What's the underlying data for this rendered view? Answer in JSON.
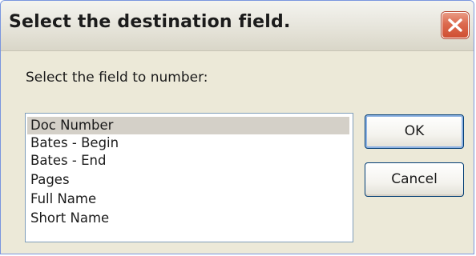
{
  "dialog": {
    "title": "Select the destination field.",
    "prompt": "Select the field to number:"
  },
  "fields_list": {
    "items": [
      {
        "label": "Doc Number",
        "selected": true
      },
      {
        "label": "Bates - Begin",
        "selected": false
      },
      {
        "label": "Bates - End",
        "selected": false
      },
      {
        "label": "Pages",
        "selected": false
      },
      {
        "label": "Full Name",
        "selected": false
      },
      {
        "label": "Short Name",
        "selected": false
      }
    ]
  },
  "buttons": {
    "ok": "OK",
    "cancel": "Cancel"
  },
  "icons": {
    "close": "close-icon"
  },
  "colors": {
    "dialog_background": "#ece9d8",
    "selection_highlight": "#d4d0c8",
    "close_button": "#dc6a4e"
  }
}
